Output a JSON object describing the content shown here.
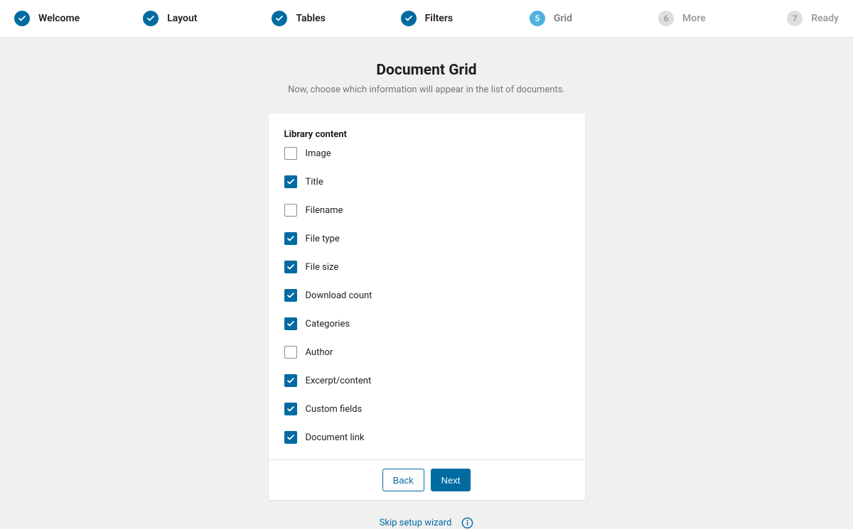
{
  "stepper": {
    "steps": [
      {
        "label": "Welcome",
        "state": "done"
      },
      {
        "label": "Layout",
        "state": "done"
      },
      {
        "label": "Tables",
        "state": "done"
      },
      {
        "label": "Filters",
        "state": "done"
      },
      {
        "label": "Grid",
        "state": "current",
        "num": "5"
      },
      {
        "label": "More",
        "state": "future",
        "num": "6"
      },
      {
        "label": "Ready",
        "state": "future",
        "num": "7"
      }
    ]
  },
  "header": {
    "title": "Document Grid",
    "subtitle": "Now, choose which information will appear in the list of documents."
  },
  "section": {
    "title": "Library content",
    "options": [
      {
        "label": "Image",
        "checked": false
      },
      {
        "label": "Title",
        "checked": true
      },
      {
        "label": "Filename",
        "checked": false
      },
      {
        "label": "File type",
        "checked": true
      },
      {
        "label": "File size",
        "checked": true
      },
      {
        "label": "Download count",
        "checked": true
      },
      {
        "label": "Categories",
        "checked": true
      },
      {
        "label": "Author",
        "checked": false
      },
      {
        "label": "Excerpt/content",
        "checked": true
      },
      {
        "label": "Custom fields",
        "checked": true
      },
      {
        "label": "Document link",
        "checked": true
      }
    ]
  },
  "footer": {
    "back": "Back",
    "next": "Next",
    "skip": "Skip setup wizard"
  }
}
